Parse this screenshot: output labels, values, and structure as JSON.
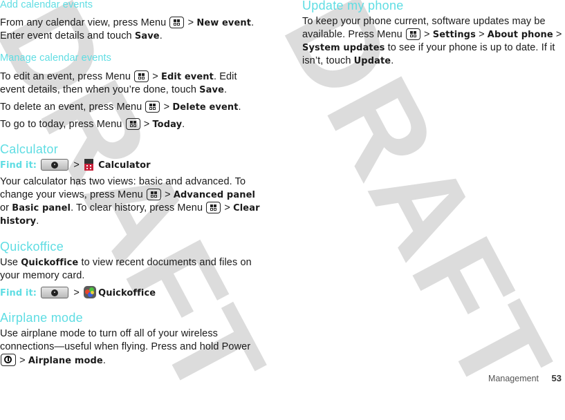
{
  "watermark": "DRAFT",
  "colors": {
    "heading": "#5fdde3",
    "watermark": "#dcdcdc",
    "text": "#1a1a1a"
  },
  "left": {
    "add_events": {
      "heading": "Add calendar events",
      "p1": {
        "t1": "From any calendar view, press Menu",
        "sep": ">",
        "b1": "New event",
        "t2": ".",
        "t3": "Enter event details and touch",
        "b2": "Save",
        "t4": "."
      }
    },
    "manage_events": {
      "heading": "Manage calendar events",
      "p1": {
        "t1": "To edit an event, press Menu",
        "sep": ">",
        "b1": "Edit event",
        "t2": ". Edit event details, then when you’re done, touch",
        "b2": "Save",
        "t3": "."
      },
      "p2": {
        "t1": "To delete an event, press Menu",
        "sep": ">",
        "b1": "Delete event",
        "t2": "."
      },
      "p3": {
        "t1": "To go to today, press Menu",
        "sep": ">",
        "b1": "Today",
        "t2": "."
      }
    },
    "calculator": {
      "heading": "Calculator",
      "find_it": {
        "label": "Find it:",
        "sep": ">",
        "app": "Calculator"
      },
      "p1": {
        "t1": "Your calculator has two views: basic and advanced. To change your views, press Menu",
        "sep": ">",
        "b1": "Advanced panel",
        "t2": "or",
        "b2": "Basic panel",
        "t3": ". To clear history, press Menu",
        "sep2": ">",
        "b3": "Clear history",
        "t4": "."
      }
    },
    "quickoffice": {
      "heading": "Quickoffice",
      "p1": {
        "t1": "Use",
        "b1": "Quickoffice",
        "t2": "to view recent documents and files on your memory card."
      },
      "find_it": {
        "label": "Find it:",
        "sep": ">",
        "app": "Quickoffice"
      }
    },
    "airplane": {
      "heading": "Airplane mode",
      "p1": {
        "t1": "Use airplane mode to turn off all of your wireless connections—useful when flying. Press and hold Power",
        "sep": ">",
        "b1": "Airplane mode",
        "t2": "."
      }
    }
  },
  "right": {
    "update": {
      "heading": "Update my phone",
      "p1": {
        "t1": "To keep your phone current, software updates may be available. Press Menu",
        "sep": ">",
        "b1": "Settings",
        "sep2": ">",
        "b2": "About phone",
        "sep3": ">",
        "b3": "System updates",
        "t2": "to see if your phone is up to date. If it isn’t, touch",
        "b4": "Update",
        "t3": "."
      }
    }
  },
  "footer": {
    "section": "Management",
    "page": "53"
  }
}
